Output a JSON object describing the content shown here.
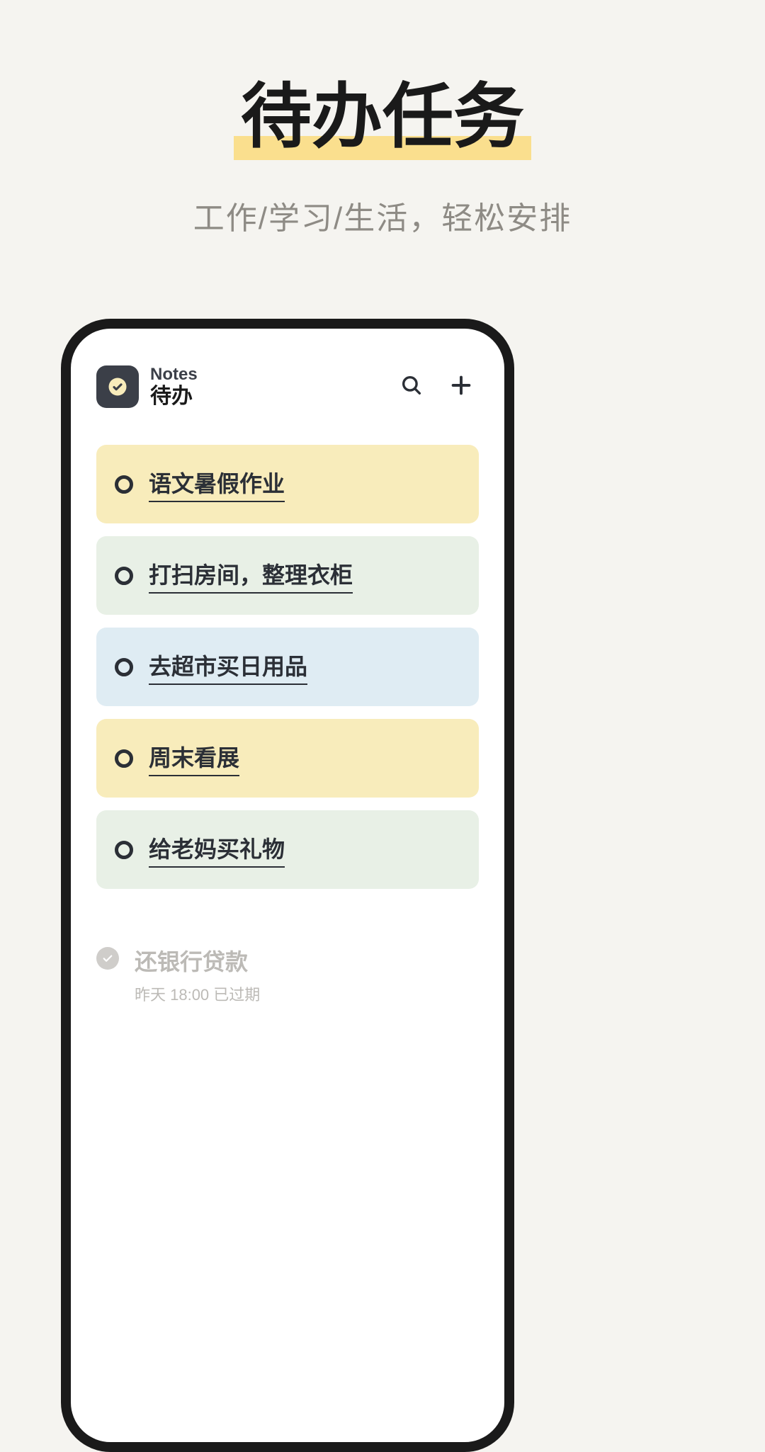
{
  "promo": {
    "title": "待办任务",
    "subtitle": "工作/学习/生活，轻松安排"
  },
  "header": {
    "app_name": "Notes",
    "section": "待办"
  },
  "tasks": [
    {
      "title": "语文暑假作业",
      "color": "yellow"
    },
    {
      "title": "打扫房间，整理衣柜",
      "color": "green"
    },
    {
      "title": "去超市买日用品",
      "color": "blue"
    },
    {
      "title": "周末看展",
      "color": "yellow"
    },
    {
      "title": "给老妈买礼物",
      "color": "green"
    }
  ],
  "completed": {
    "title": "还银行贷款",
    "meta": "昨天 18:00  已过期"
  }
}
